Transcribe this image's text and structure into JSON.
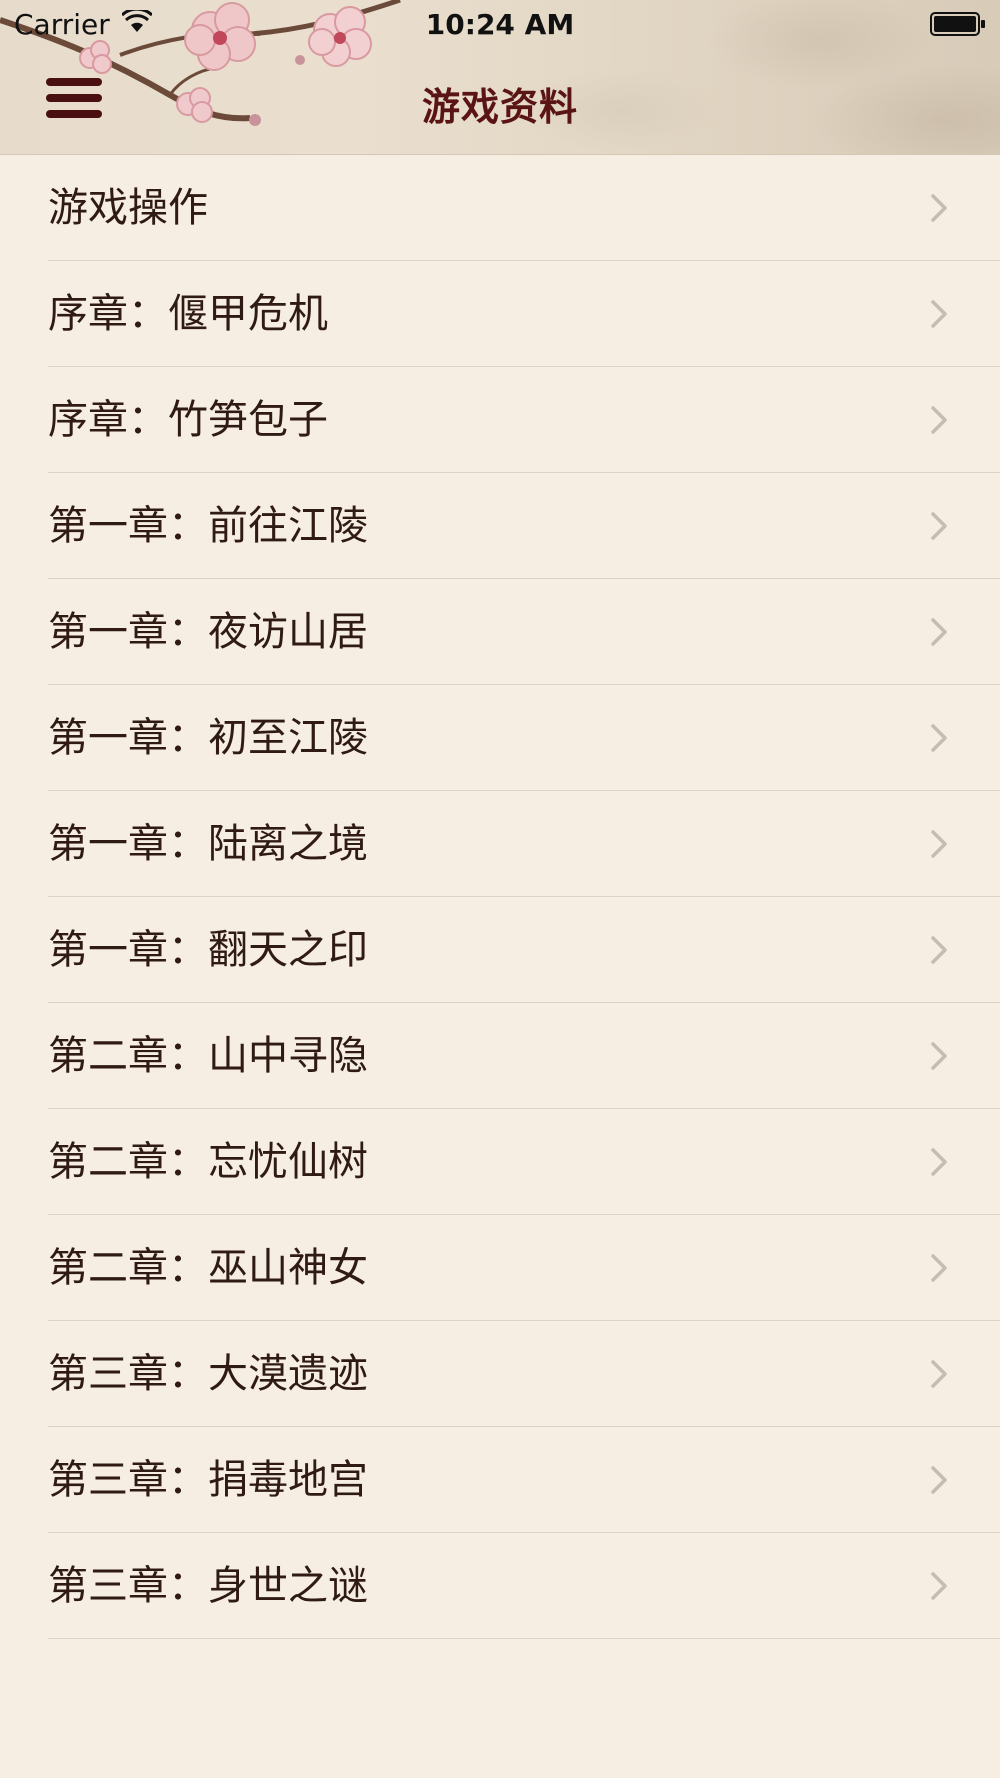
{
  "status_bar": {
    "carrier": "Carrier",
    "time": "10:24 AM"
  },
  "nav": {
    "title": "游戏资料"
  },
  "list": {
    "items": [
      {
        "label": "游戏操作"
      },
      {
        "label": "序章：偃甲危机"
      },
      {
        "label": "序章：竹笋包子"
      },
      {
        "label": "第一章：前往江陵"
      },
      {
        "label": "第一章：夜访山居"
      },
      {
        "label": "第一章：初至江陵"
      },
      {
        "label": "第一章：陆离之境"
      },
      {
        "label": "第一章：翻天之印"
      },
      {
        "label": "第二章：山中寻隐"
      },
      {
        "label": "第二章：忘忧仙树"
      },
      {
        "label": "第二章：巫山神女"
      },
      {
        "label": "第三章：大漠遗迹"
      },
      {
        "label": "第三章：捐毒地宫"
      },
      {
        "label": "第三章：身世之谜"
      }
    ]
  },
  "colors": {
    "background": "#f6eee3",
    "title": "#5a1414",
    "item_text": "#2f1b14",
    "chevron": "#c6bcb0",
    "menu_icon": "#4a0f10"
  },
  "icons": {
    "menu": "hamburger-menu-icon",
    "chevron": "chevron-right-icon",
    "wifi": "wifi-icon",
    "battery": "battery-icon"
  }
}
